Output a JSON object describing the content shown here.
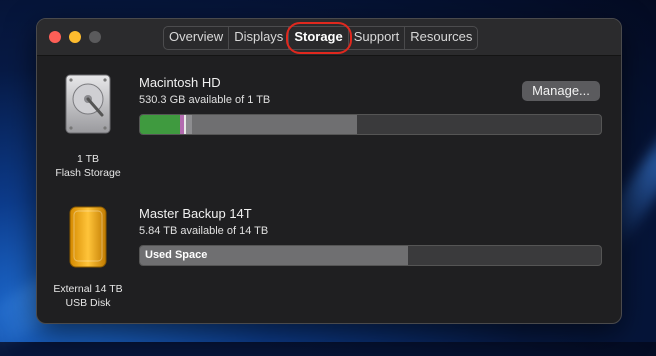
{
  "window": {
    "tabs": [
      {
        "label": "Overview"
      },
      {
        "label": "Displays"
      },
      {
        "label": "Storage",
        "selected": true
      },
      {
        "label": "Support"
      },
      {
        "label": "Resources"
      }
    ]
  },
  "drives": [
    {
      "name": "Macintosh HD",
      "available": "530.3 GB available of 1 TB",
      "caption_line1": "1 TB",
      "caption_line2": "Flash Storage",
      "icon": "hard-drive-icon",
      "button": "Manage...",
      "usage_fraction": 0.47
    },
    {
      "name": "Master Backup 14T",
      "available": "5.84 TB available of 14 TB",
      "caption_line1": "External 14 TB",
      "caption_line2": "USB Disk",
      "icon": "external-disk-icon",
      "bar_label": "Used Space",
      "usage_fraction": 0.58
    }
  ],
  "colors": {
    "apps": "#3f9a3f",
    "system": "#5a5a5c",
    "other": "#b36bb0",
    "used": "#6f6f71",
    "free": "#3a3a3c",
    "highlight": "#e0281e"
  }
}
